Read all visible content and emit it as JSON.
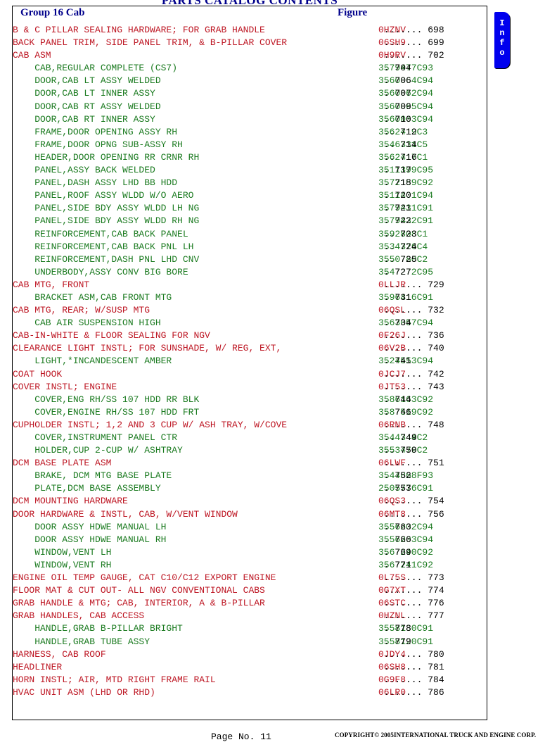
{
  "document": {
    "title": "PARTS CATALOG CONTENTS"
  },
  "header": {
    "group_label": "Group 16 Cab",
    "figure_label": "Figure"
  },
  "info_tab": {
    "label": "I\nn\nf\no",
    "color": "#0000EE"
  },
  "colors": {
    "level0": "#BD1522",
    "level1": "#1A7A1F",
    "header": "#00008B",
    "leader": "#000000"
  },
  "footer": {
    "page_label": "Page No. 11",
    "copyright": "COPYRIGHT© 2005INTERNATIONAL TRUCK AND ENGINE CORP."
  },
  "entries": [
    {
      "level": 0,
      "desc": "B & C PILLAR SEALING HARDWARE; FOR GRAB HANDLE",
      "code": "0HZNV",
      "leader": " ....... ",
      "figure": "698"
    },
    {
      "level": 0,
      "desc": "BACK PANEL TRIM, SIDE PANEL TRIM, & B-PILLAR COVER",
      "code": "06SH9",
      "leader": " ....... ",
      "figure": "699"
    },
    {
      "level": 0,
      "desc": "CAB ASM",
      "code": "0H9RV",
      "leader": " ....... ",
      "figure": "702"
    },
    {
      "level": 1,
      "desc": "    CAB,REGULAR COMPLETE (CS7)",
      "code": "3579477C93",
      "leader": " . ",
      "figure": "704"
    },
    {
      "level": 1,
      "desc": "    DOOR,CAB LT ASSY WELDED",
      "code": "3560064C94",
      "leader": " . ",
      "figure": "706"
    },
    {
      "level": 1,
      "desc": "    DOOR,CAB LT INNER ASSY",
      "code": "3560062C94",
      "leader": " . ",
      "figure": "707"
    },
    {
      "level": 1,
      "desc": "    DOOR,CAB RT ASSY WELDED",
      "code": "3560065C94",
      "leader": " . ",
      "figure": "709"
    },
    {
      "level": 1,
      "desc": "    DOOR,CAB RT INNER ASSY",
      "code": "3560063C94",
      "leader": " . ",
      "figure": "710"
    },
    {
      "level": 1,
      "desc": "    FRAME,DOOR OPENING ASSY RH",
      "code": "3562419C3",
      "leader": " .. ",
      "figure": "712"
    },
    {
      "level": 1,
      "desc": "    FRAME,DOOR OPNG SUB-ASSY RH",
      "code": "3546331C5",
      "leader": " .. ",
      "figure": "714"
    },
    {
      "level": 1,
      "desc": "    HEADER,DOOR OPENING RR CRNR RH",
      "code": "3562417C1",
      "leader": " .. ",
      "figure": "716"
    },
    {
      "level": 1,
      "desc": "    PANEL,ASSY BACK WELDED",
      "code": "3511399C95",
      "leader": " . ",
      "figure": "717"
    },
    {
      "level": 1,
      "desc": "    PANEL,DASH ASSY LHD BB HDD",
      "code": "3572159C92",
      "leader": " . ",
      "figure": "718"
    },
    {
      "level": 1,
      "desc": "    PANEL,ROOF ASSY WLDD W/O AERO",
      "code": "3511401C94",
      "leader": " . ",
      "figure": "720"
    },
    {
      "level": 1,
      "desc": "    PANEL,SIDE BDY ASSY WLDD LH NG",
      "code": "3579431C91",
      "leader": " . ",
      "figure": "721"
    },
    {
      "level": 1,
      "desc": "    PANEL,SIDE BDY ASSY WLDD RH NG",
      "code": "3579432C91",
      "leader": " . ",
      "figure": "722"
    },
    {
      "level": 1,
      "desc": "    REINFORCEMENT,CAB BACK PANEL",
      "code": "3592808C1",
      "leader": " .. ",
      "figure": "723"
    },
    {
      "level": 1,
      "desc": "    REINFORCEMENT,CAB BACK PNL LH",
      "code": "3534376C4",
      "leader": " .. ",
      "figure": "724"
    },
    {
      "level": 1,
      "desc": "    REINFORCEMENT,DASH PNL LHD CNV",
      "code": "3550780C2",
      "leader": " .. ",
      "figure": "725"
    },
    {
      "level": 1,
      "desc": "    UNDERBODY,ASSY CONV BIG BORE",
      "code": "3547272C95",
      "leader": " . ",
      "figure": "727"
    },
    {
      "level": 0,
      "desc": "CAB MTG, FRONT",
      "code": "0LLJR",
      "leader": " ....... ",
      "figure": "729"
    },
    {
      "level": 1,
      "desc": "    BRACKET ASM,CAB FRONT MTG",
      "code": "3596416C91",
      "leader": " . ",
      "figure": "731"
    },
    {
      "level": 0,
      "desc": "CAB MTG, REAR; W/SUSP MTG",
      "code": "06QSL",
      "leader": " ....... ",
      "figure": "732"
    },
    {
      "level": 1,
      "desc": "    CAB AIR SUSPENSION HIGH",
      "code": "3563057C94",
      "leader": " . ",
      "figure": "734"
    },
    {
      "level": 0,
      "desc": "CAB-IN-WHITE & FLOOR SEALING FOR NGV",
      "code": "0F26J",
      "leader": " ....... ",
      "figure": "736"
    },
    {
      "level": 0,
      "desc": "CLEARANCE LIGHT INSTL; FOR SUNSHADE, W/ REG, EXT,",
      "code": "06V2B",
      "leader": " ....... ",
      "figure": "740"
    },
    {
      "level": 1,
      "desc": "    LIGHT,*INCANDESCENT AMBER",
      "code": "3524553C94",
      "leader": " . ",
      "figure": "741"
    },
    {
      "level": 0,
      "desc": "COAT HOOK",
      "code": "0JCJ7",
      "leader": " ....... ",
      "figure": "742"
    },
    {
      "level": 0,
      "desc": "COVER INSTL; ENGINE",
      "code": "0JT53",
      "leader": " ....... ",
      "figure": "743"
    },
    {
      "level": 1,
      "desc": "    COVER,ENG RH/SS 107 HDD RR BLK",
      "code": "3586163C92",
      "leader": " . ",
      "figure": "744"
    },
    {
      "level": 1,
      "desc": "    COVER,ENGINE RH/SS 107 HDD FRT",
      "code": "3587519C92",
      "leader": " . ",
      "figure": "746"
    },
    {
      "level": 0,
      "desc": "CUPHOLDER INSTL; 1,2 AND 3 CUP W/ ASH TRAY, W/COVE",
      "code": "06RNB",
      "leader": " ....... ",
      "figure": "748"
    },
    {
      "level": 1,
      "desc": "    COVER,INSTRUMENT PANEL CTR",
      "code": "3544344C2",
      "leader": " .. ",
      "figure": "749"
    },
    {
      "level": 1,
      "desc": "    HOLDER,CUP 2-CUP W/ ASHTRAY",
      "code": "3553479C2",
      "leader": " .. ",
      "figure": "750"
    },
    {
      "level": 0,
      "desc": "DCM BASE PLATE ASM",
      "code": "06LWF",
      "leader": " ....... ",
      "figure": "751"
    },
    {
      "level": 1,
      "desc": "    BRAKE, DCM MTG BASE PLATE",
      "code": "3544868F93",
      "leader": " . ",
      "figure": "752"
    },
    {
      "level": 1,
      "desc": "    PLATE,DCM BASE ASSEMBLY",
      "code": "2505776C91",
      "leader": " . ",
      "figure": "753"
    },
    {
      "level": 0,
      "desc": "DCM MOUNTING HARDWARE",
      "code": "06QS3",
      "leader": " ....... ",
      "figure": "754"
    },
    {
      "level": 0,
      "desc": "DOOR HARDWARE & INSTL, CAB, W/VENT WINDOW",
      "code": "06MT8",
      "leader": " ....... ",
      "figure": "756"
    },
    {
      "level": 1,
      "desc": "    DOOR ASSY HDWE MANUAL LH",
      "code": "3556202C94",
      "leader": " . ",
      "figure": "763"
    },
    {
      "level": 1,
      "desc": "    DOOR ASSY HDWE MANUAL RH",
      "code": "3556203C94",
      "leader": " . ",
      "figure": "766"
    },
    {
      "level": 1,
      "desc": "    WINDOW,VENT LH",
      "code": "3567240C92",
      "leader": " . ",
      "figure": "769"
    },
    {
      "level": 1,
      "desc": "    WINDOW,VENT RH",
      "code": "3567241C92",
      "leader": " . ",
      "figure": "771"
    },
    {
      "level": 0,
      "desc": "ENGINE OIL TEMP GAUGE, CAT C10/C12 EXPORT ENGINE",
      "code": "0L75S",
      "leader": " ....... ",
      "figure": "773"
    },
    {
      "level": 0,
      "desc": "FLOOR MAT & CUT OUT- ALL NGV CONVENTIONAL CABS",
      "code": "0G7XT",
      "leader": " ....... ",
      "figure": "774"
    },
    {
      "level": 0,
      "desc": "GRAB HANDLE & MTG; CAB, INTERIOR, A & B-PILLAR",
      "code": "06STC",
      "leader": " ....... ",
      "figure": "776"
    },
    {
      "level": 0,
      "desc": "GRAB HANDLES, CAB ACCESS",
      "code": "0HZNL",
      "leader": " ....... ",
      "figure": "777"
    },
    {
      "level": 1,
      "desc": "    HANDLE,GRAB B-PILLAR BRIGHT",
      "code": "3558130C91",
      "leader": " . ",
      "figure": "778"
    },
    {
      "level": 1,
      "desc": "    HANDLE,GRAB TUBE ASSY",
      "code": "3558120C91",
      "leader": " . ",
      "figure": "779"
    },
    {
      "level": 0,
      "desc": "HARNESS, CAB ROOF",
      "code": "0JDY4",
      "leader": " ....... ",
      "figure": "780"
    },
    {
      "level": 0,
      "desc": "HEADLINER",
      "code": "06SH8",
      "leader": " ....... ",
      "figure": "781"
    },
    {
      "level": 0,
      "desc": "HORN INSTL; AIR, MTD RIGHT FRAME RAIL",
      "code": "0G9F8",
      "leader": " ....... ",
      "figure": "784"
    },
    {
      "level": 0,
      "desc": "HVAC UNIT ASM (LHD OR RHD)",
      "code": "06LR0",
      "leader": " ....... ",
      "figure": "786"
    }
  ]
}
